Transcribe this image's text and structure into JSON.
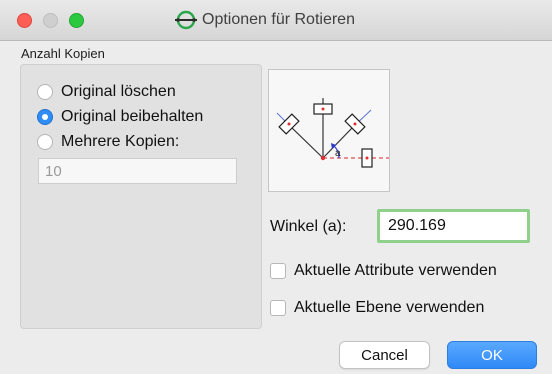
{
  "window": {
    "title": "Optionen für Rotieren",
    "app_icon": "circle-line-icon"
  },
  "copies": {
    "group_label": "Anzahl Kopien",
    "options": [
      {
        "label": "Original löschen",
        "selected": false
      },
      {
        "label": "Original beibehalten",
        "selected": true
      },
      {
        "label": "Mehrere Kopien:",
        "selected": false
      }
    ],
    "count_value": "10"
  },
  "preview": {
    "icon": "rotation-diagram-icon",
    "angle_symbol": "a"
  },
  "angle": {
    "label": "Winkel (a):",
    "value": "290.169"
  },
  "checkboxes": [
    {
      "label": "Aktuelle Attribute verwenden",
      "checked": false
    },
    {
      "label": "Aktuelle Ebene verwenden",
      "checked": false
    }
  ],
  "buttons": {
    "cancel": "Cancel",
    "ok": "OK"
  },
  "colors": {
    "accent": "#2f8df5",
    "focus_ring": "#8fd08b",
    "close": "#fd5f57",
    "maximize": "#2bc840"
  }
}
